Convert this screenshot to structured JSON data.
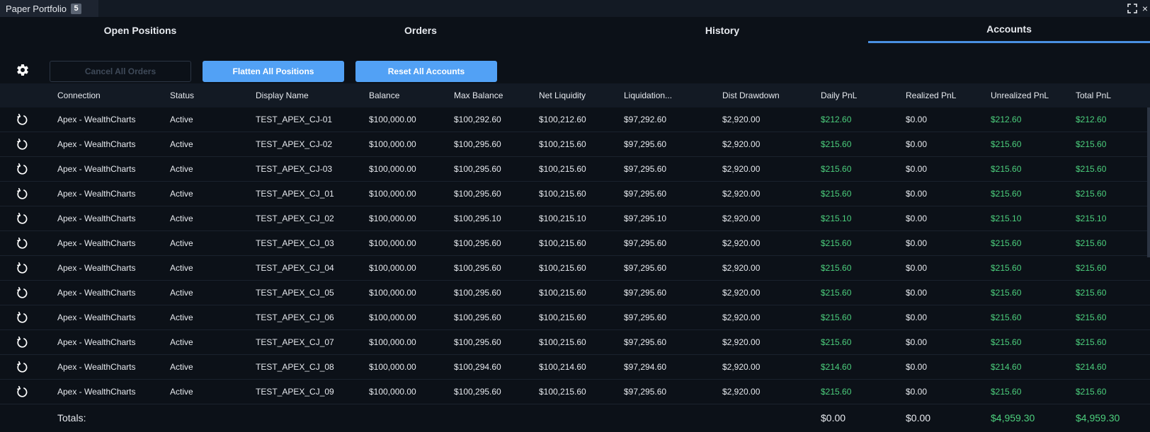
{
  "window": {
    "title": "Paper Portfolio",
    "badge": "5",
    "close_glyph": "×"
  },
  "tabs": [
    {
      "label": "Open Positions",
      "active": false
    },
    {
      "label": "Orders",
      "active": false
    },
    {
      "label": "History",
      "active": false
    },
    {
      "label": "Accounts",
      "active": true
    }
  ],
  "toolbar": {
    "settings_icon": "gear-icon",
    "cancel_all_label": "Cancel All Orders",
    "flatten_all_label": "Flatten All Positions",
    "reset_all_label": "Reset All Accounts"
  },
  "table": {
    "columns": [
      "Connection",
      "Status",
      "Display Name",
      "Balance",
      "Max Balance",
      "Net Liquidity",
      "Liquidation...",
      "Dist Drawdown",
      "Daily PnL",
      "Realized PnL",
      "Unrealized PnL",
      "Total PnL"
    ],
    "rows": [
      [
        "Apex - WealthCharts",
        "Active",
        "TEST_APEX_CJ-01",
        "$100,000.00",
        "$100,292.60",
        "$100,212.60",
        "$97,292.60",
        "$2,920.00",
        "$212.60",
        "$0.00",
        "$212.60",
        "$212.60"
      ],
      [
        "Apex - WealthCharts",
        "Active",
        "TEST_APEX_CJ-02",
        "$100,000.00",
        "$100,295.60",
        "$100,215.60",
        "$97,295.60",
        "$2,920.00",
        "$215.60",
        "$0.00",
        "$215.60",
        "$215.60"
      ],
      [
        "Apex - WealthCharts",
        "Active",
        "TEST_APEX_CJ-03",
        "$100,000.00",
        "$100,295.60",
        "$100,215.60",
        "$97,295.60",
        "$2,920.00",
        "$215.60",
        "$0.00",
        "$215.60",
        "$215.60"
      ],
      [
        "Apex - WealthCharts",
        "Active",
        "TEST_APEX_CJ_01",
        "$100,000.00",
        "$100,295.60",
        "$100,215.60",
        "$97,295.60",
        "$2,920.00",
        "$215.60",
        "$0.00",
        "$215.60",
        "$215.60"
      ],
      [
        "Apex - WealthCharts",
        "Active",
        "TEST_APEX_CJ_02",
        "$100,000.00",
        "$100,295.10",
        "$100,215.10",
        "$97,295.10",
        "$2,920.00",
        "$215.10",
        "$0.00",
        "$215.10",
        "$215.10"
      ],
      [
        "Apex - WealthCharts",
        "Active",
        "TEST_APEX_CJ_03",
        "$100,000.00",
        "$100,295.60",
        "$100,215.60",
        "$97,295.60",
        "$2,920.00",
        "$215.60",
        "$0.00",
        "$215.60",
        "$215.60"
      ],
      [
        "Apex - WealthCharts",
        "Active",
        "TEST_APEX_CJ_04",
        "$100,000.00",
        "$100,295.60",
        "$100,215.60",
        "$97,295.60",
        "$2,920.00",
        "$215.60",
        "$0.00",
        "$215.60",
        "$215.60"
      ],
      [
        "Apex - WealthCharts",
        "Active",
        "TEST_APEX_CJ_05",
        "$100,000.00",
        "$100,295.60",
        "$100,215.60",
        "$97,295.60",
        "$2,920.00",
        "$215.60",
        "$0.00",
        "$215.60",
        "$215.60"
      ],
      [
        "Apex - WealthCharts",
        "Active",
        "TEST_APEX_CJ_06",
        "$100,000.00",
        "$100,295.60",
        "$100,215.60",
        "$97,295.60",
        "$2,920.00",
        "$215.60",
        "$0.00",
        "$215.60",
        "$215.60"
      ],
      [
        "Apex - WealthCharts",
        "Active",
        "TEST_APEX_CJ_07",
        "$100,000.00",
        "$100,295.60",
        "$100,215.60",
        "$97,295.60",
        "$2,920.00",
        "$215.60",
        "$0.00",
        "$215.60",
        "$215.60"
      ],
      [
        "Apex - WealthCharts",
        "Active",
        "TEST_APEX_CJ_08",
        "$100,000.00",
        "$100,294.60",
        "$100,214.60",
        "$97,294.60",
        "$2,920.00",
        "$214.60",
        "$0.00",
        "$214.60",
        "$214.60"
      ],
      [
        "Apex - WealthCharts",
        "Active",
        "TEST_APEX_CJ_09",
        "$100,000.00",
        "$100,295.60",
        "$100,215.60",
        "$97,295.60",
        "$2,920.00",
        "$215.60",
        "$0.00",
        "$215.60",
        "$215.60"
      ]
    ],
    "row_action_icon": "reset-icon"
  },
  "totals": {
    "label": "Totals:",
    "daily_pnl": "$0.00",
    "realized_pnl": "$0.00",
    "unrealized_pnl": "$4,959.30",
    "total_pnl": "$4,959.30"
  },
  "colors": {
    "accent": "#4a90e2",
    "button_primary": "#52a1f5",
    "positive": "#4cd07d",
    "background": "#0c1118"
  }
}
